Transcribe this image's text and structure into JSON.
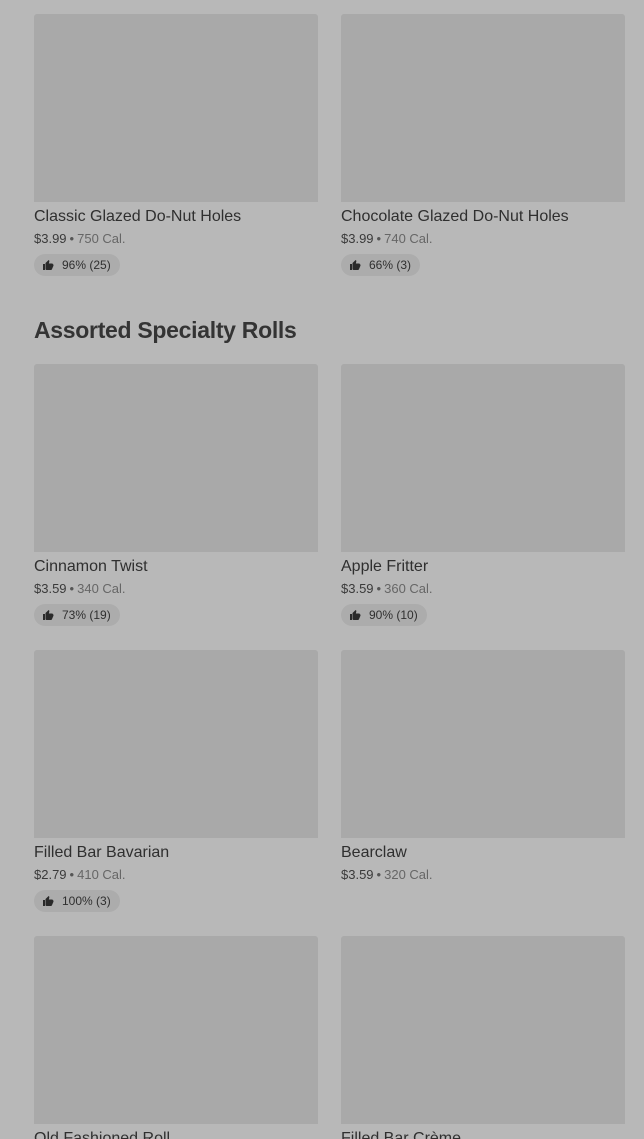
{
  "top_row": [
    {
      "name": "Classic Glazed Do-Nut Holes",
      "price": "$3.99",
      "separator": "•",
      "calories": "750 Cal.",
      "rating": "96% (25)"
    },
    {
      "name": "Chocolate Glazed Do-Nut Holes",
      "price": "$3.99",
      "separator": "•",
      "calories": "740 Cal.",
      "rating": "66% (3)"
    }
  ],
  "section": {
    "title": "Assorted Specialty Rolls",
    "items": [
      {
        "name": "Cinnamon Twist",
        "price": "$3.59",
        "separator": "•",
        "calories": "340 Cal.",
        "rating": "73% (19)"
      },
      {
        "name": "Apple Fritter",
        "price": "$3.59",
        "separator": "•",
        "calories": "360 Cal.",
        "rating": "90% (10)"
      },
      {
        "name": "Filled Bar Bavarian",
        "price": "$2.79",
        "separator": "•",
        "calories": "410 Cal.",
        "rating": "100% (3)"
      },
      {
        "name": "Bearclaw",
        "price": "$3.59",
        "separator": "•",
        "calories": "320 Cal."
      },
      {
        "name": "Old Fashioned Roll"
      },
      {
        "name": "Filled Bar Crème"
      }
    ]
  },
  "icons": {
    "rating": "thumbs-up-icon"
  }
}
